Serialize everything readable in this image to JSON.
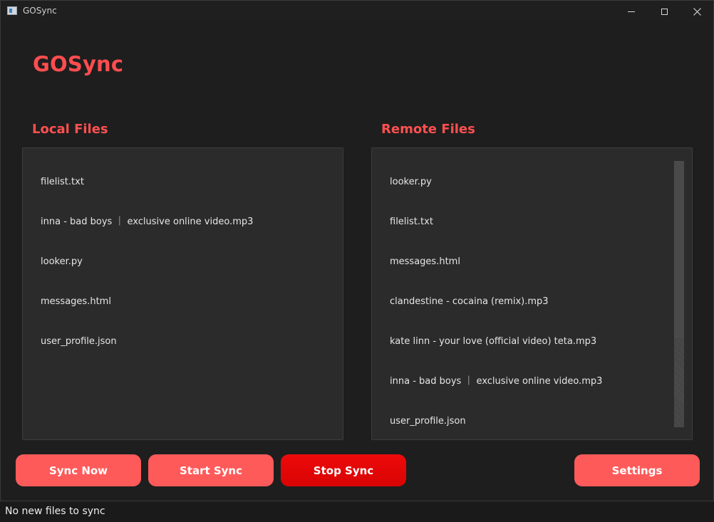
{
  "window": {
    "title": "GOSync"
  },
  "app": {
    "title": "GOSync"
  },
  "local": {
    "title": "Local Files",
    "files": [
      "filelist.txt",
      "inna - bad boys ｜ exclusive online video.mp3",
      "looker.py",
      "messages.html",
      "user_profile.json"
    ]
  },
  "remote": {
    "title": "Remote Files",
    "files": [
      "looker.py",
      "filelist.txt",
      "messages.html",
      "clandestine - cocaina (remix).mp3",
      "kate linn - your love (official video) teta.mp3",
      "inna - bad boys ｜ exclusive online video.mp3",
      "user_profile.json"
    ]
  },
  "buttons": {
    "sync_now": "Sync Now",
    "start_sync": "Start Sync",
    "stop_sync": "Stop Sync",
    "settings": "Settings"
  },
  "status": {
    "text": "No new files to sync"
  },
  "colors": {
    "accent": "#ff5a5a",
    "title_red": "#ff4d4f",
    "stop_red": "#e60808",
    "panel_bg": "#2b2b2b",
    "window_bg": "#1e1e1e"
  },
  "icons": [
    "app-icon",
    "minimize-icon",
    "maximize-icon",
    "close-icon"
  ]
}
